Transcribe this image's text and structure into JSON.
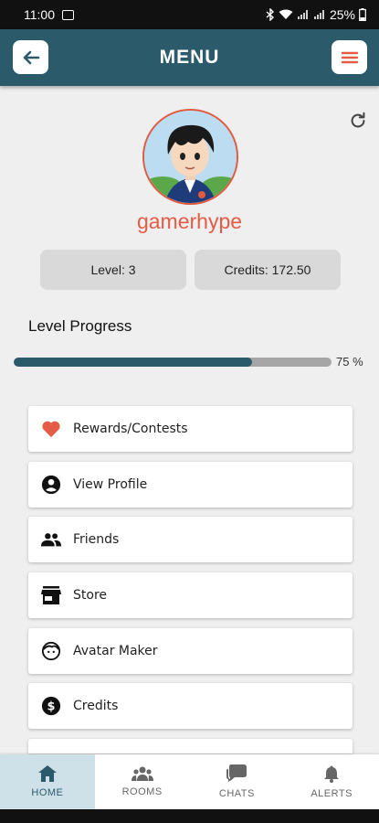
{
  "status_bar": {
    "time": "11:00",
    "battery": "25%"
  },
  "header": {
    "title": "MENU"
  },
  "profile": {
    "username": "gamerhype",
    "level_label": "Level: 3",
    "credits_label": "Credits: 172.50"
  },
  "progress": {
    "title": "Level Progress",
    "value_percent": 75,
    "label": "75 %"
  },
  "menu": {
    "items": [
      {
        "label": "Rewards/Contests",
        "icon": "heart-icon"
      },
      {
        "label": "View Profile",
        "icon": "account-circle-icon"
      },
      {
        "label": "Friends",
        "icon": "people-icon"
      },
      {
        "label": "Store",
        "icon": "store-icon"
      },
      {
        "label": "Avatar Maker",
        "icon": "face-icon"
      },
      {
        "label": "Credits",
        "icon": "dollar-icon"
      }
    ]
  },
  "bottom_nav": {
    "tabs": [
      {
        "label": "HOME",
        "icon": "home-icon",
        "active": true
      },
      {
        "label": "ROOMS",
        "icon": "group-icon"
      },
      {
        "label": "CHATS",
        "icon": "chat-icon"
      },
      {
        "label": "ALERTS",
        "icon": "bell-icon"
      }
    ]
  },
  "colors": {
    "primary": "#2b5a6b",
    "accent": "#e45c45",
    "active_tab_bg": "#cfe1e8"
  }
}
